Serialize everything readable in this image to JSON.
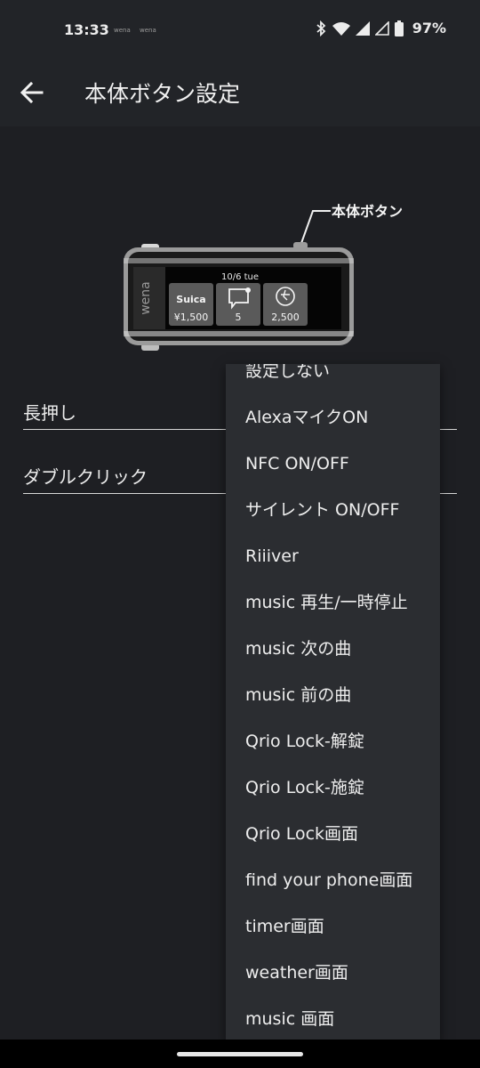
{
  "status_bar": {
    "time": "13:33",
    "app_icons": [
      "wena",
      "wena"
    ],
    "battery": "97%",
    "icons": [
      "bluetooth-icon",
      "wifi-icon",
      "signal-icon",
      "signal-icon",
      "battery-icon"
    ]
  },
  "app_bar": {
    "title": "本体ボタン設定",
    "back_icon": "arrow-back-icon"
  },
  "device_image": {
    "callout": "本体ボタン",
    "brand": "wena",
    "date": "10/6 tue",
    "tiles": [
      {
        "label": "Suica",
        "value": "¥1,500"
      },
      {
        "label": "",
        "value": "5"
      },
      {
        "label": "",
        "value": "2,500"
      }
    ]
  },
  "settings": [
    {
      "label": "長押し"
    },
    {
      "label": "ダブルクリック"
    }
  ],
  "dropdown": {
    "items": [
      "設定しない",
      "AlexaマイクON",
      "NFC ON/OFF",
      "サイレント ON/OFF",
      "Riiiver",
      "music 再生/一時停止",
      "music 次の曲",
      "music 前の曲",
      "Qrio Lock-解錠",
      "Qrio Lock-施錠",
      "Qrio Lock画面",
      "find your phone画面",
      "timer画面",
      "weather画面",
      "music 画面"
    ]
  },
  "colors": {
    "background": "#1e1f23",
    "bar": "#222428",
    "menu": "#2b2d31"
  }
}
